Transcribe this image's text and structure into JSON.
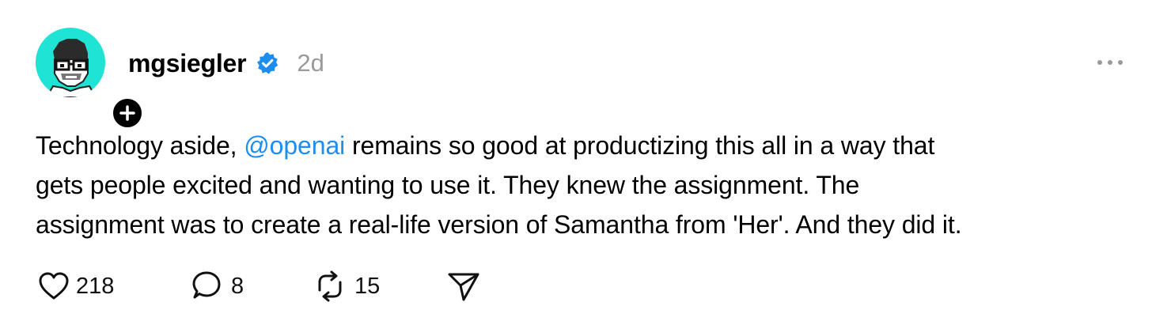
{
  "post": {
    "author": {
      "username": "mgsiegler",
      "verified": true,
      "avatar_bg": "#1ee3d5",
      "follow_icon": "plus-icon"
    },
    "time": "2d",
    "menu_icon": "more-dots-icon",
    "text": {
      "before_mention": "Technology aside, ",
      "mention": "@openai",
      "after_mention_line1": " remains so good at productizing this all in a way that",
      "line2": "gets people excited and wanting to use it. They knew the assignment. The",
      "line3": "assignment was to create a real-life version of Samantha from 'Her'. And they did it."
    },
    "actions": {
      "like": {
        "icon": "heart-icon",
        "count": "218"
      },
      "reply": {
        "icon": "comment-icon",
        "count": "8"
      },
      "repost": {
        "icon": "repost-icon",
        "count": "15"
      },
      "share": {
        "icon": "send-icon"
      }
    },
    "colors": {
      "mention": "#1d8ef0",
      "verified": "#1d8ef0",
      "timestamp": "#9a9a9a"
    }
  }
}
